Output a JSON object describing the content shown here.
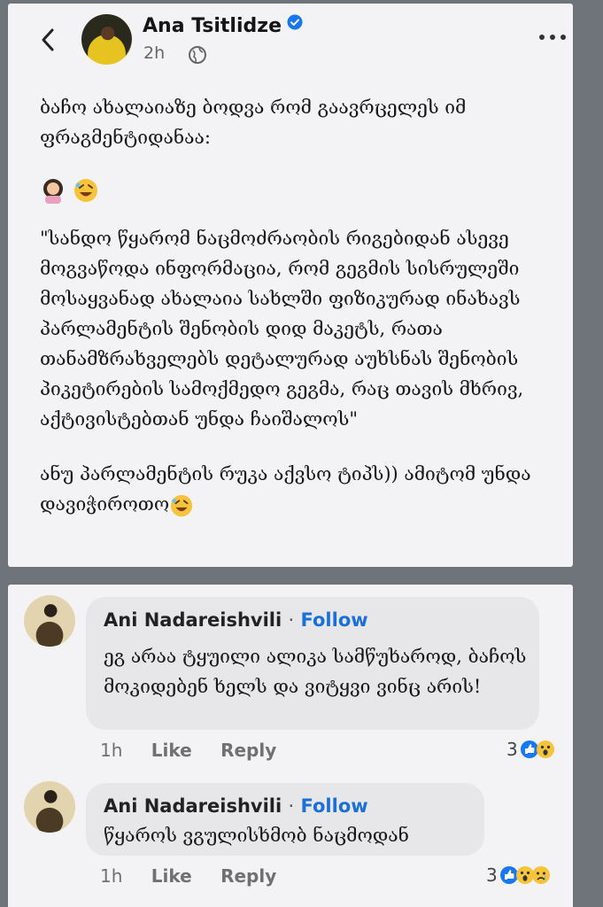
{
  "post": {
    "author": "Ana Tsitlidze",
    "time": "2h",
    "paragraph1": "ბაჩო ახალაიაზე ბოდვა რომ გაავრცელეს იმ ფრაგმენტიდანაა:",
    "quote": "\"სანდო წყარომ ნაცმოძრაობის რიგებიდან ასევე მოგვაწოდა ინფორმაცია, რომ გეგმის სისრულეში მოსაყვანად ახალაია სახლში ფიზიკურად ინახავს პარლამენტის შენობის დიდ მაკეტს, რათა თანამზრახველებს დეტალურად აუხსნას შენობის პიკეტირების სამოქმედო გეგმა, რაც თავის მხრივ, აქტივისტებთან უნდა ჩაიშალოს\"",
    "closing": "ანუ პარლამენტის რუკა აქვსო ტიპს)) ამიტომ უნდა დავიჭიროთო"
  },
  "comments": [
    {
      "name": "Ani Nadareishvili",
      "dot": "·",
      "follow": "Follow",
      "text": "ეგ არაა ტყუილი ალიკა სამწუხაროდ, ბაჩოს მოკიდებენ ხელს და ვიტყვი ვინც არის!",
      "time": "1h",
      "like": "Like",
      "reply": "Reply",
      "reactions": "3"
    },
    {
      "name": "Ani Nadareishvili",
      "dot": "·",
      "follow": "Follow",
      "text": "წყაროს ვგულისხმობ ნაცმოდან",
      "time": "1h",
      "like": "Like",
      "reply": "Reply",
      "reactions": "3"
    }
  ],
  "icons": {
    "back": "chevron-left-icon",
    "verified": "verified-badge-icon",
    "audience": "globe-icon",
    "more": "more-horizontal-icon",
    "like_reaction": "like-reaction-icon",
    "wow_reaction": "wow-reaction-icon",
    "sad_reaction": "sad-reaction-icon"
  },
  "colors": {
    "background": "#6e7479",
    "card": "#f3f3f5",
    "bubble": "#e7e7ea",
    "link": "#1b6fd8",
    "verified": "#1877f2"
  }
}
